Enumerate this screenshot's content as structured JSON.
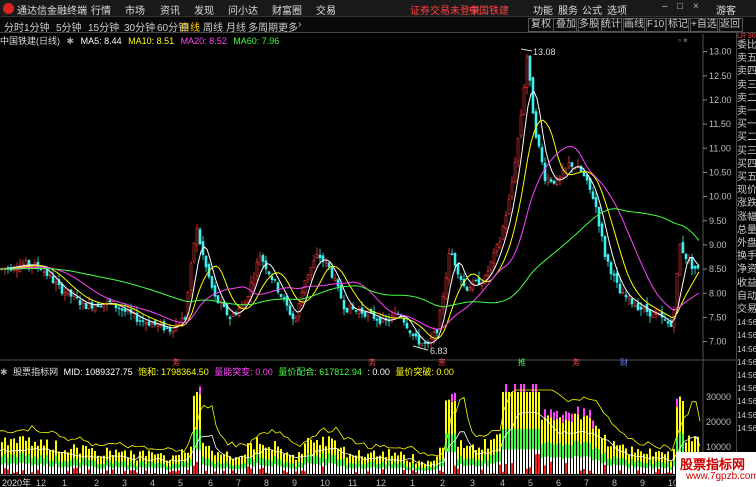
{
  "app": {
    "title": "通达信金融终端",
    "menu": [
      "行情",
      "市场",
      "资讯",
      "发现",
      "问小达",
      "财富圈",
      "交易"
    ],
    "notice": "证券交易未登录",
    "stock_tag": "中国铁建",
    "top_right_menu": [
      "功能",
      "服务",
      "公式",
      "选项"
    ],
    "user": "游客"
  },
  "toolbar": {
    "periods": [
      "分时",
      "1分钟",
      "5分钟",
      "15分钟",
      "30分钟",
      "60分钟",
      "日线",
      "周线",
      "月线",
      "多周期",
      "更多"
    ],
    "active_period": "日线",
    "right_buttons": [
      "复权",
      "叠加",
      "多股",
      "统计",
      "画线",
      "F10",
      "标记",
      "+自选",
      "返回"
    ]
  },
  "main_chart": {
    "title": "中国铁建(日线)",
    "ma": [
      {
        "label": "MA5: 8.44",
        "color": "#ffffff"
      },
      {
        "label": "MA10: 8.51",
        "color": "#ffff00"
      },
      {
        "label": "MA20: 8.52",
        "color": "#ff44ff"
      },
      {
        "label": "MA60: 7.96",
        "color": "#44ff44"
      }
    ],
    "y_ticks": [
      "13.00",
      "12.50",
      "12.00",
      "11.50",
      "11.00",
      "10.50",
      "10.00",
      "9.50",
      "9.00",
      "8.50",
      "8.00",
      "7.50",
      "7.00"
    ],
    "high_label": "13.08",
    "low_label": "6.83",
    "markers": [
      {
        "text": "务",
        "color": "#ff4040"
      },
      {
        "text": "务",
        "color": "#ff4040"
      },
      {
        "text": "亲",
        "color": "#ff4040"
      },
      {
        "text": "推",
        "color": "#44ff44"
      },
      {
        "text": "务",
        "color": "#ff4040"
      },
      {
        "text": "财",
        "color": "#6688ff"
      }
    ]
  },
  "sub_chart": {
    "title": "股票指标网",
    "items": [
      {
        "label": "MID: 1089327.75",
        "color": "#ffffff"
      },
      {
        "label": "饱和: 1798364.50",
        "color": "#ffff00"
      },
      {
        "label": "量能突变: 0.00",
        "color": "#ff44ff"
      },
      {
        "label": "量价配合: 617812.94",
        "color": "#44ff44"
      },
      {
        "label": ": 0.00",
        "color": "#ffffff"
      },
      {
        "label": "量价突破: 0.00",
        "color": "#ffff00"
      }
    ],
    "y_ticks": [
      "30000",
      "20000",
      "10000"
    ]
  },
  "right_panel": {
    "top_label": "LR 300",
    "items": [
      "委比",
      "卖五",
      "卖四",
      "卖三",
      "卖二",
      "卖一",
      "买一",
      "买二",
      "买三",
      "买四",
      "买五",
      "现价",
      "涨跌",
      "涨幅",
      "总量",
      "外盘",
      "换手",
      "净资",
      "收益",
      "自动",
      "交易",
      "14:56",
      "14:56",
      "14:56",
      "14:56",
      "14:56",
      "14:56",
      "14:56",
      "14:56",
      "14:56"
    ]
  },
  "date_axis": [
    "2020年",
    "12",
    "1",
    "2",
    "3",
    "4",
    "5",
    "6",
    "7",
    "8",
    "9",
    "10",
    "11",
    "12",
    "1",
    "2",
    "3",
    "4",
    "5",
    "6",
    "7",
    "8",
    "9",
    "10",
    "11",
    "12"
  ],
  "watermark": {
    "text": "股票指标网",
    "url": "www.7gpzb.com"
  },
  "chart_data": {
    "type": "line",
    "title": "中国铁建(日线)",
    "xlabel": "",
    "ylabel": "",
    "ylim": [
      6.75,
      13.3
    ],
    "x": [
      "2020-12",
      "2021-01",
      "2021-02",
      "2021-03",
      "2021-04",
      "2021-05",
      "2021-06",
      "2021-07",
      "2021-08",
      "2021-09",
      "2021-10",
      "2021-11",
      "2021-12",
      "2022-01",
      "2022-02",
      "2022-03",
      "2022-04",
      "2022-05",
      "2022-06",
      "2022-07",
      "2022-08",
      "2022-09",
      "2022-10",
      "2022-11",
      "2022-12"
    ],
    "series": [
      {
        "name": "MA5",
        "values": [
          8.6,
          8.55,
          8.1,
          7.75,
          7.45,
          7.25,
          8.7,
          8.2,
          7.5,
          8.4,
          8.8,
          7.6,
          7.4,
          7.8,
          7.5,
          7.1,
          7.0,
          8.5,
          8.0,
          9.1,
          12.9,
          11.0,
          10.6,
          10.2,
          9.2,
          8.3,
          7.7,
          7.5,
          8.9,
          8.5
        ]
      },
      {
        "name": "MA60",
        "values": [
          8.35,
          8.3,
          8.1,
          7.95,
          7.75,
          7.5,
          7.6,
          7.8,
          7.7,
          7.9,
          8.1,
          7.85,
          7.55,
          7.6,
          7.5,
          7.3,
          7.2,
          7.6,
          7.9,
          8.5,
          10.0,
          10.5,
          10.6,
          10.3,
          9.7,
          8.8,
          8.1,
          7.6,
          7.75,
          7.95
        ]
      }
    ]
  }
}
